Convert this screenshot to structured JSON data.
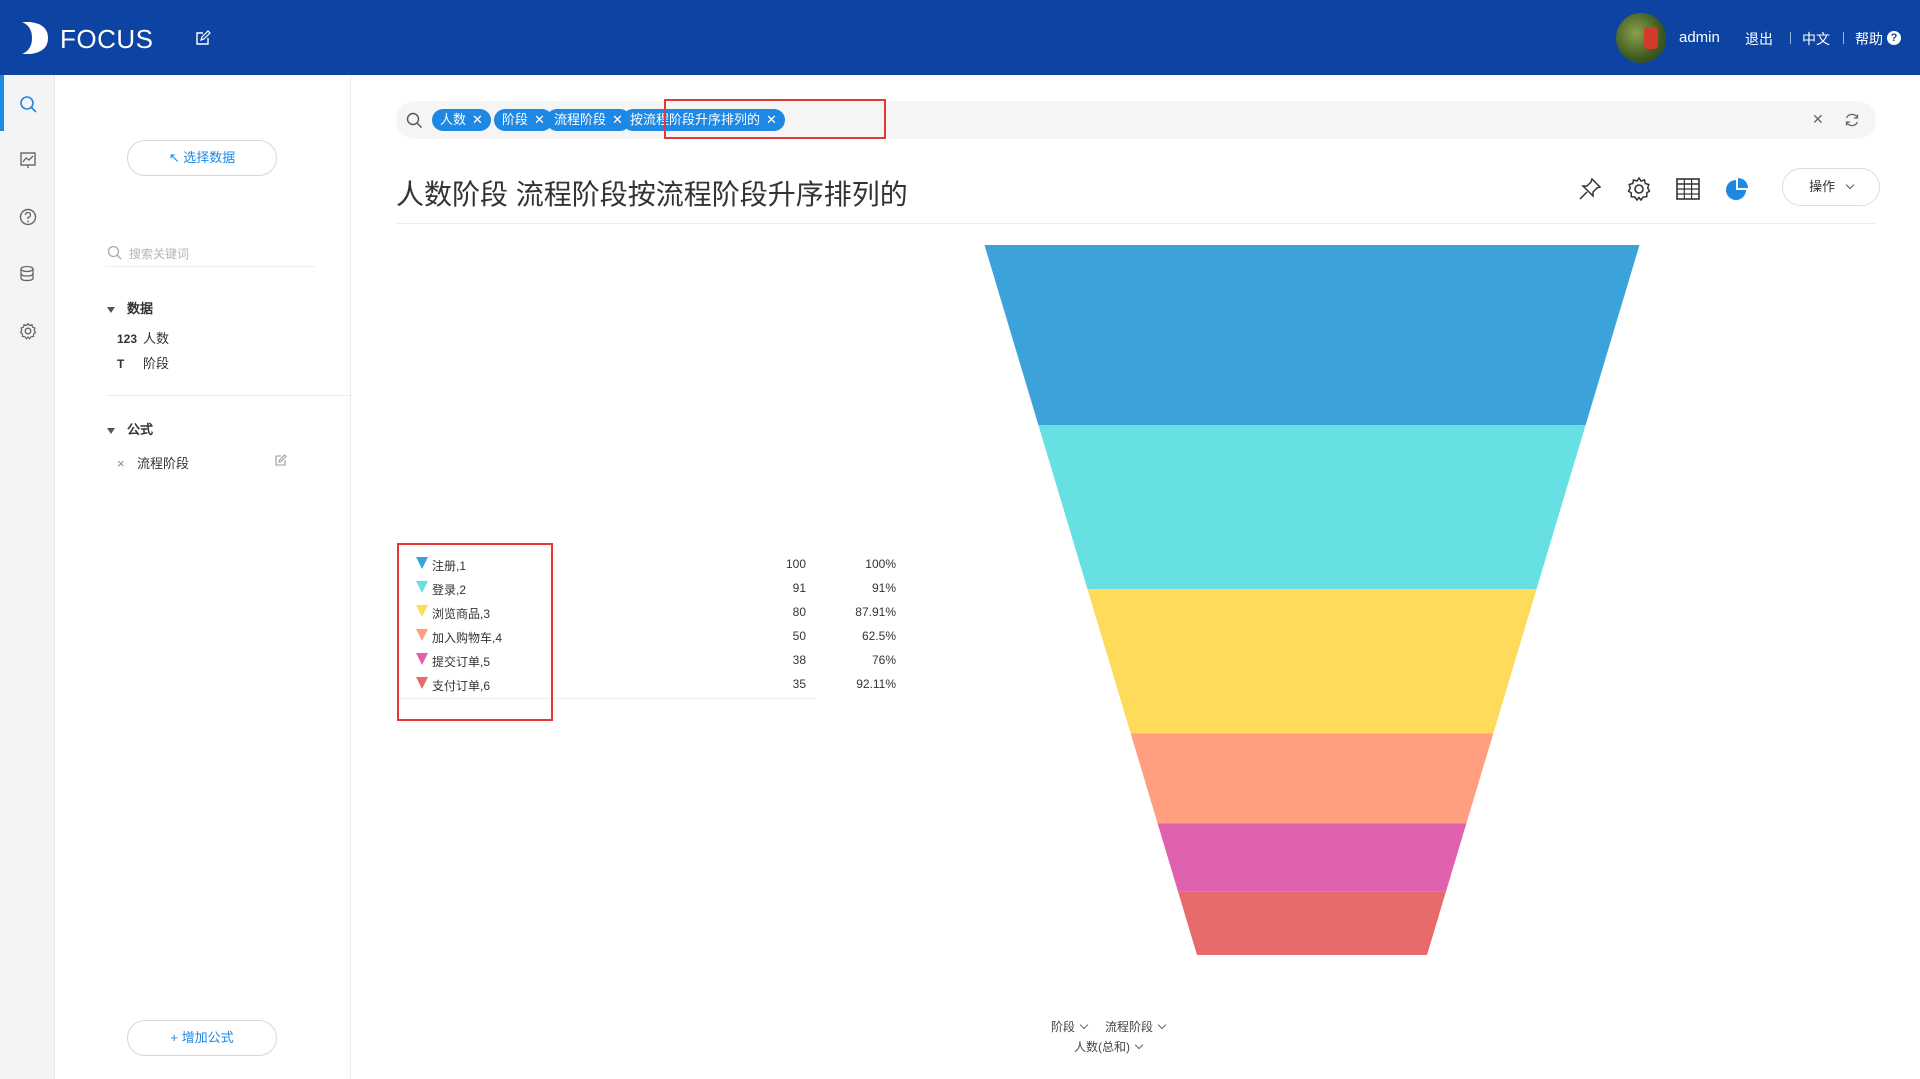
{
  "app": {
    "logo_text": "FOCUS",
    "user": "admin",
    "logout": "退出",
    "language": "中文",
    "help": "帮助"
  },
  "sidebar": {
    "select_data": "↖ 选择数据",
    "search_placeholder": "搜索关键词",
    "data_section": "数据",
    "fields": [
      {
        "type_tag": "123",
        "label": "人数"
      },
      {
        "type_tag": "T",
        "label": "阶段"
      }
    ],
    "formula_section": "公式",
    "formulas": [
      {
        "label": "流程阶段"
      }
    ],
    "add_formula": "+ 增加公式"
  },
  "query": {
    "chips": [
      "人数",
      "阶段",
      "流程阶段",
      "按流程阶段升序排列的"
    ]
  },
  "title": "人数阶段 流程阶段按流程阶段升序排列的",
  "toolbar": {
    "operations": "操作"
  },
  "chart_data": {
    "type": "funnel",
    "series": [
      {
        "name": "注册,1",
        "value": 100,
        "percent": "100%",
        "color": "#3ba3d9"
      },
      {
        "name": "登录,2",
        "value": 91,
        "percent": "91%",
        "color": "#67e0e3"
      },
      {
        "name": "浏览商品,3",
        "value": 80,
        "percent": "87.91%",
        "color": "#ffdb5c"
      },
      {
        "name": "加入购物车,4",
        "value": 50,
        "percent": "62.5%",
        "color": "#ff9f7f"
      },
      {
        "name": "提交订单,5",
        "value": 38,
        "percent": "76%",
        "color": "#e062ae"
      },
      {
        "name": "支付订单,6",
        "value": 35,
        "percent": "92.11%",
        "color": "#e86b6b"
      }
    ],
    "x_controls": [
      "阶段",
      "流程阶段"
    ],
    "y_control": "人数(总和)"
  }
}
